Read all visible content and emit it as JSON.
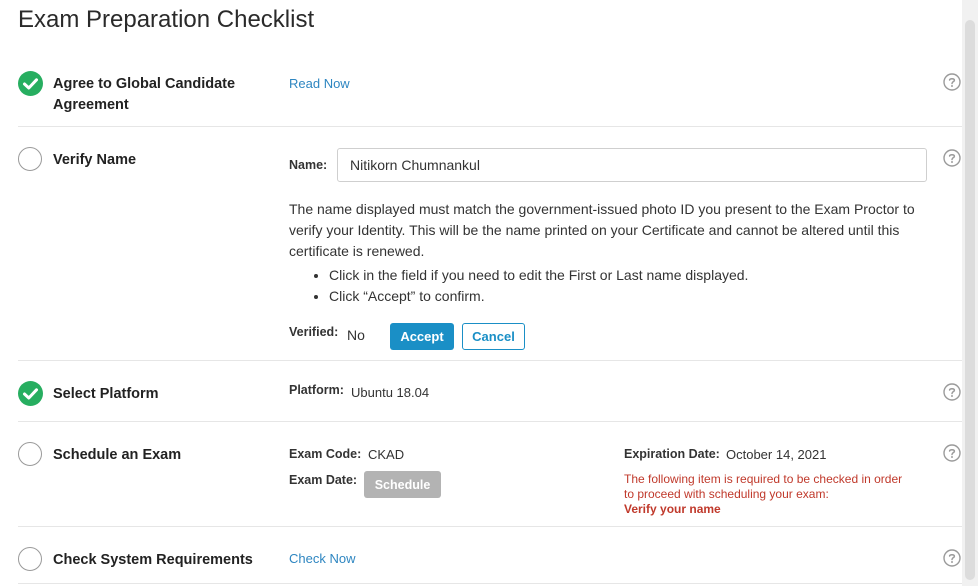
{
  "title": "Exam Preparation Checklist",
  "tasks": [
    {
      "label": "Agree to Global Candidate Agreement",
      "done": true
    },
    {
      "label": "Verify Name",
      "done": false
    },
    {
      "label": "Select Platform",
      "done": true
    },
    {
      "label": "Schedule an Exam",
      "done": false
    },
    {
      "label": "Check System Requirements",
      "done": false
    }
  ],
  "agreement": {
    "link": "Read Now"
  },
  "verify_name": {
    "name_label": "Name:",
    "name_value": "Nitikorn Chumnankul",
    "description": "The name displayed must match the government-issued photo ID you present to the Exam Proctor to verify your Identity. This will be the name printed on your Certificate and cannot be altered until this certificate is renewed.",
    "bullets": [
      "Click in the field if you need to edit the First or Last name displayed.",
      "Click “Accept” to confirm."
    ],
    "verified_label": "Verified:",
    "verified_value": "No",
    "accept_label": "Accept",
    "cancel_label": "Cancel"
  },
  "platform": {
    "label": "Platform:",
    "value": "Ubuntu 18.04"
  },
  "schedule": {
    "exam_code_label": "Exam Code:",
    "exam_code_value": "CKAD",
    "exam_date_label": "Exam Date:",
    "schedule_button": "Schedule",
    "expiration_label": "Expiration Date:",
    "expiration_value": "October 14, 2021",
    "warning_text": "The following item is required to be checked in order to proceed with scheduling your exam:",
    "warning_item": "Verify your name"
  },
  "system": {
    "link": "Check Now"
  },
  "icons": {
    "check": "check-circle-icon",
    "pending": "empty-circle-icon",
    "help": "question-circle-icon"
  },
  "colors": {
    "success": "#27ae60",
    "accent": "#1a8fc6",
    "warning": "#c0392b",
    "disabled": "#b3b3b3"
  }
}
